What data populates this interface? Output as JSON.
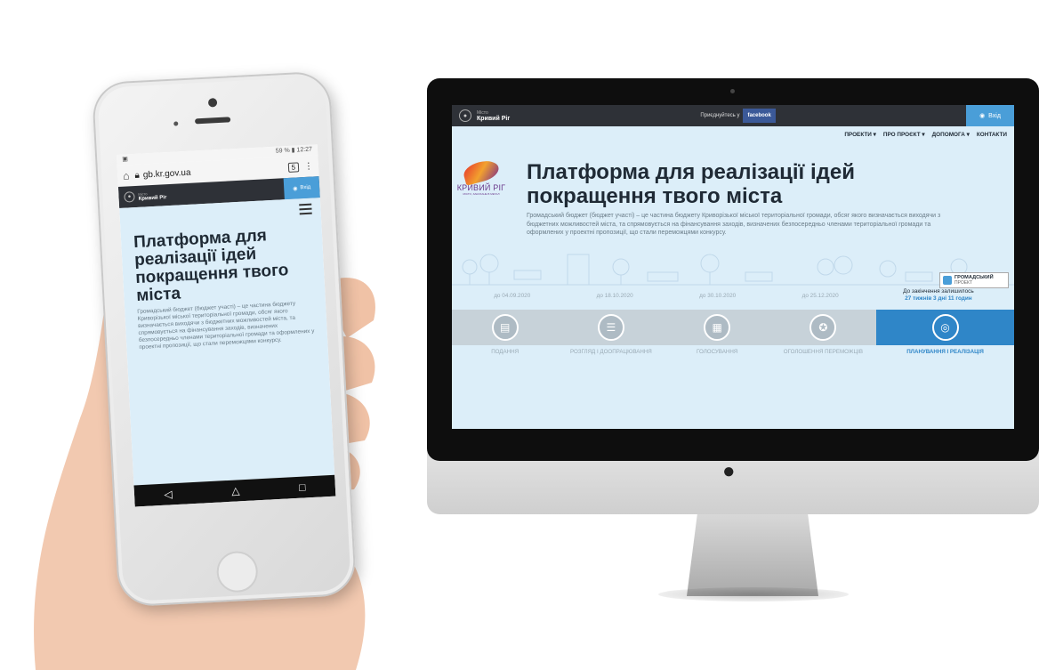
{
  "phone": {
    "status_time": "12:27",
    "status_battery": "59 %",
    "url": "gb.kr.gov.ua",
    "tab_count": "5",
    "city_caption": "Місто",
    "city_name": "Кривий Ріг",
    "login_label": "Вхід",
    "title": "Платформа для реалізації ідей покращення твого міста",
    "description": "Громадський бюджет (бюджет участі) – це частина бюджету Криворізької міської територіальної громади, обсяг якого визначається виходячи з бюджетних можливостей міста, та спрямовується на фінансування заходів, визначених безпосередньо членами територіальної громади та оформлених у проектні пропозиції, що стали переможцями конкурсу."
  },
  "monitor": {
    "city_caption": "Місто",
    "city_name": "Кривий Ріг",
    "join_text": "Приєднуйтесь у",
    "facebook_label": "facebook",
    "login_label": "Вхід",
    "menu": [
      "ПРОЕКТИ ▾",
      "ПРО ПРОЄКТ ▾",
      "ДОПОМОГА ▾",
      "КОНТАКТИ"
    ],
    "logo_name": "КРИВИЙ РІГ",
    "logo_sub": "МІСТО, ЗАКОХАНЕ В МЕТАЛ",
    "title_line1": "Платформа для реалізації ідей",
    "title_line2": "покращення твого міста",
    "description": "Громадський бюджет (бюджет участі) – це частина бюджету Криворізької міської територіальної громади, обсяг якого визначається виходячи з бюджетних можливостей міста, та спрямовується на фінансування заходів, визначених безпосередньо членами територіальної громади та оформлених у проектні пропозиції, що стали переможцями конкурсу.",
    "badge_title": "ГРОМАДСЬКИЙ",
    "badge_sub": "ПРОЕКТ",
    "dates": [
      "до 04.09.2020",
      "до 18.10.2020",
      "до 30.10.2020",
      "до 25.12.2020"
    ],
    "remain_text": "До закінчення залишилось",
    "remain_value": "27 тижнів 3 дні 11 годин",
    "steps": [
      "ПОДАННЯ",
      "РОЗГЛЯД І ДООПРАЦЮВАННЯ",
      "ГОЛОСУВАННЯ",
      "ОГОЛОШЕННЯ ПЕРЕМОЖЦІВ",
      "ПЛАНУВАННЯ І РЕАЛІЗАЦІЯ"
    ],
    "active_step": 4,
    "colors": {
      "accent": "#2f86c8",
      "header": "#2e3137",
      "background": "#dceef9"
    }
  }
}
